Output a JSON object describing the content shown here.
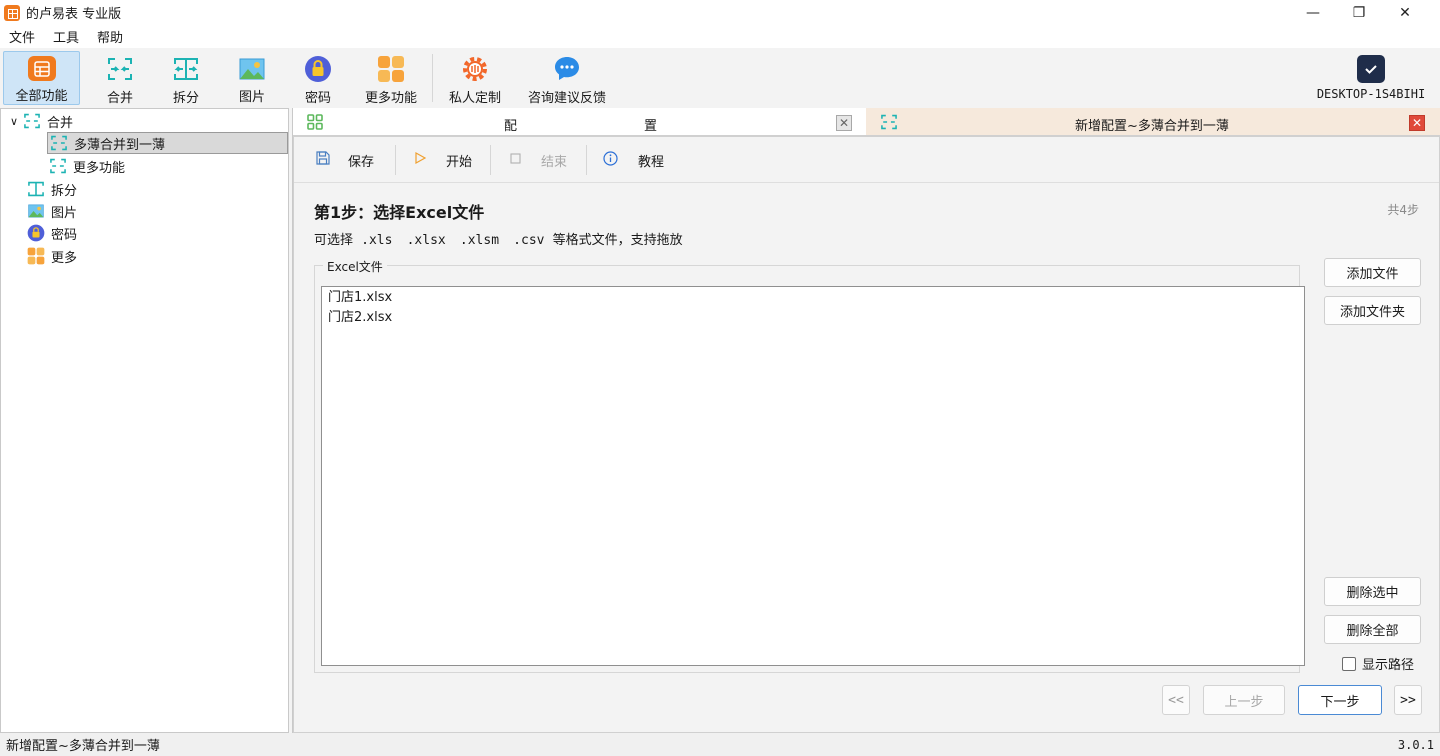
{
  "window": {
    "title": "的卢易表 专业版",
    "minimize": "—",
    "restore": "❐",
    "close": "✕"
  },
  "menu": {
    "items": [
      "文件",
      "工具",
      "帮助"
    ]
  },
  "toolbar": {
    "items": [
      {
        "label": "全部功能",
        "icon": "app-grid-icon"
      },
      {
        "label": "合并",
        "icon": "merge-icon"
      },
      {
        "label": "拆分",
        "icon": "split-icon"
      },
      {
        "label": "图片",
        "icon": "image-icon"
      },
      {
        "label": "密码",
        "icon": "lock-icon"
      },
      {
        "label": "更多功能",
        "icon": "more-grid-icon"
      },
      {
        "label": "私人定制",
        "icon": "gear-icon"
      },
      {
        "label": "咨询建议反馈",
        "icon": "chat-icon"
      }
    ],
    "user": "DESKTOP-1S4BIHI"
  },
  "tree": {
    "items": [
      {
        "label": "合并",
        "expander": "∨"
      },
      {
        "label": "多薄合并到一薄"
      },
      {
        "label": "更多功能"
      },
      {
        "label": "拆分"
      },
      {
        "label": "图片"
      },
      {
        "label": "密码"
      },
      {
        "label": "更多"
      }
    ]
  },
  "tabs": [
    {
      "label_a": "配",
      "label_b": "置",
      "close": "✕"
    },
    {
      "label": "新增配置~多薄合并到一薄",
      "close": "✕"
    }
  ],
  "subtoolbar": {
    "save": "保存",
    "start": "开始",
    "stop": "结束",
    "tutorial": "教程"
  },
  "step": {
    "title": "第1步：选择Excel文件",
    "count": "共4步",
    "desc_prefix": "可选择",
    "formats": [
      ".xls",
      ".xlsx",
      ".xlsm",
      ".csv"
    ],
    "desc_suffix": "等格式文件，支持拖放"
  },
  "file_group": {
    "label": "Excel文件",
    "files": [
      "门店1.xlsx",
      "门店2.xlsx"
    ]
  },
  "side_buttons": {
    "add_file": "添加文件",
    "add_folder": "添加文件夹",
    "delete_selected": "删除选中",
    "delete_all": "删除全部",
    "show_path": "显示路径"
  },
  "nav": {
    "first": "<<",
    "prev": "上一步",
    "next": "下一步",
    "last": ">>"
  },
  "status": {
    "text": "新增配置~多薄合并到一薄",
    "version": "3.0.1"
  },
  "colors": {
    "accent_orange": "#f07a1e",
    "teal": "#1cb3b3",
    "blue": "#2b8be6",
    "active_tab_bg": "#f6e9dc",
    "close_red": "#e04a3a"
  }
}
